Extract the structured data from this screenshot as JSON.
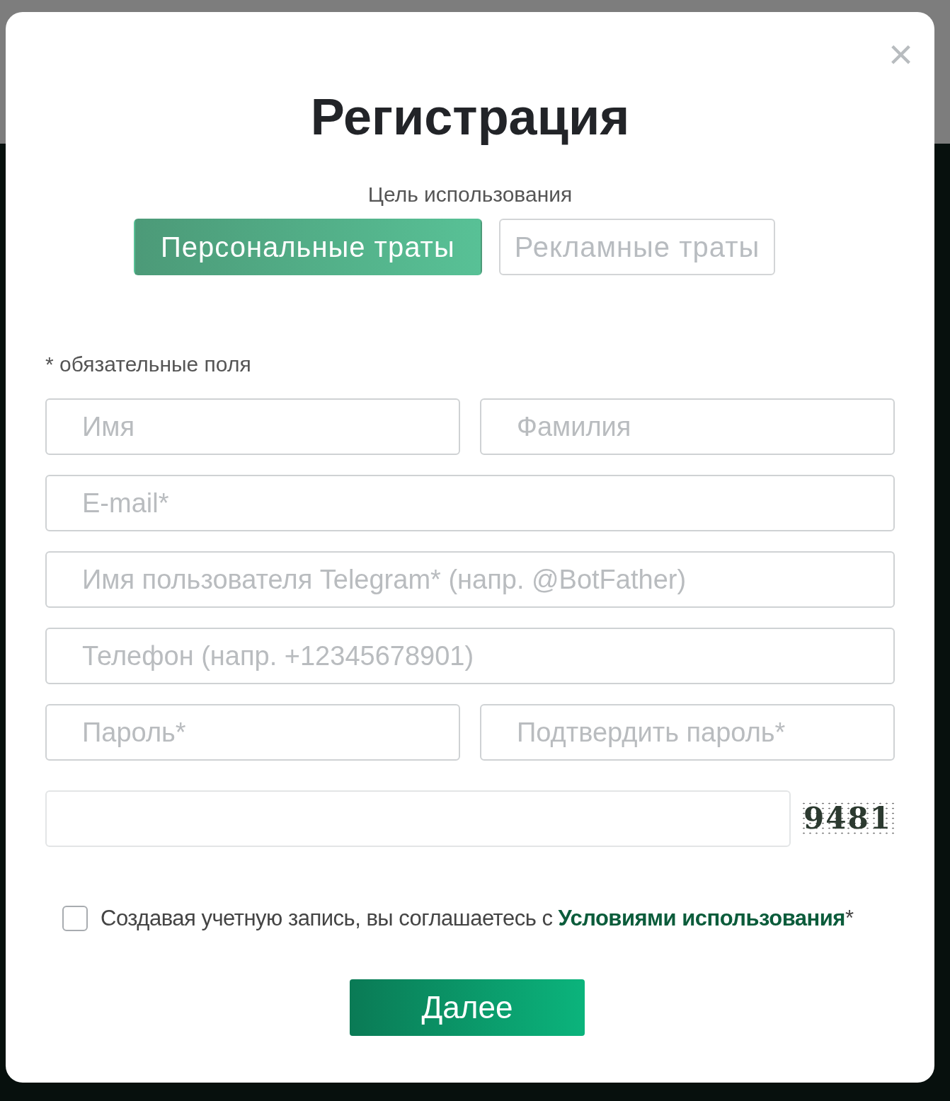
{
  "dialog": {
    "title": "Регистрация",
    "close": "×"
  },
  "purpose": {
    "label": "Цель использования",
    "options": [
      {
        "label": "Персональные траты",
        "selected": true
      },
      {
        "label": "Рекламные траты",
        "selected": false
      }
    ]
  },
  "required_note": "* обязательные поля",
  "field_rows": [
    [
      {
        "placeholder": "Имя"
      },
      {
        "placeholder": "Фамилия"
      }
    ],
    [
      {
        "placeholder": "E-mail*"
      }
    ],
    [
      {
        "placeholder": "Имя пользователя Telegram* (напр. @BotFather)"
      }
    ],
    [
      {
        "placeholder": "Телефон (напр. +12345678901)"
      }
    ],
    [
      {
        "placeholder": "Пароль*"
      },
      {
        "placeholder": "Подтвердить пароль*"
      }
    ]
  ],
  "captcha": {
    "code": "9481"
  },
  "agreement": {
    "checked": false,
    "text": "Создавая учетную запись, вы соглашаетесь с ",
    "link": "Условиями использования",
    "suffix": "*"
  },
  "submit": "Далее"
}
